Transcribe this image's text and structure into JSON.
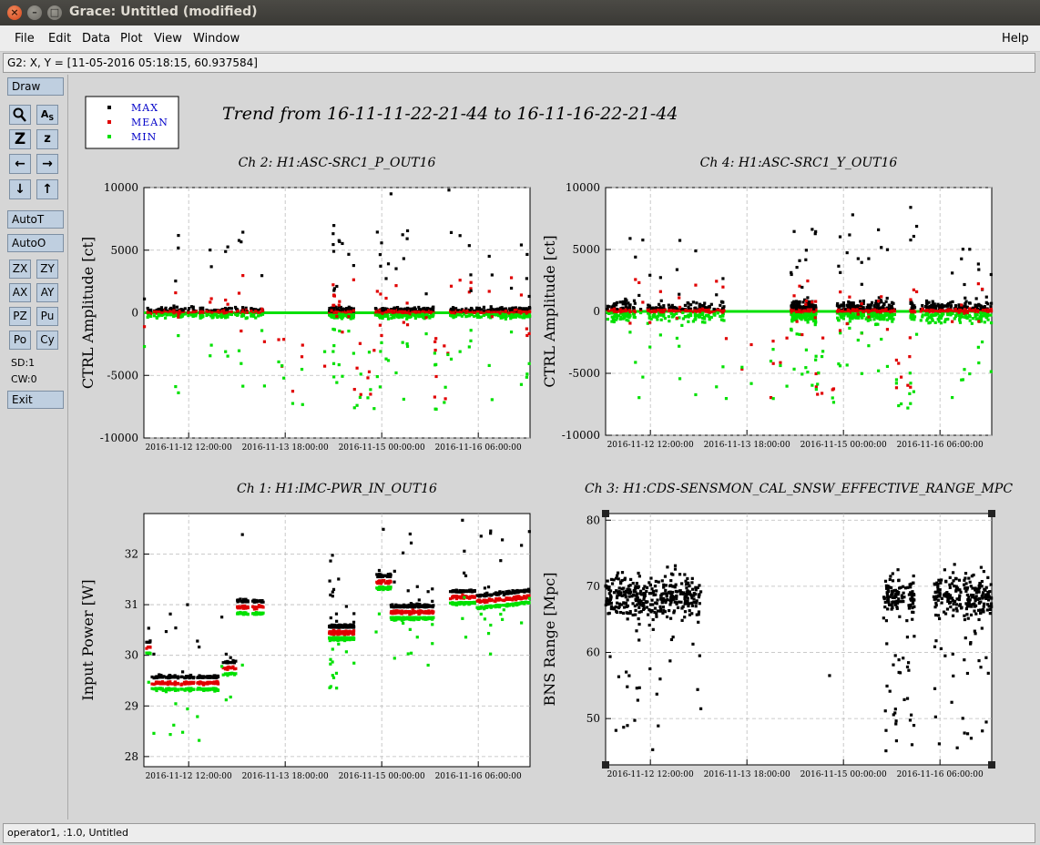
{
  "window": {
    "title": "Grace: Untitled (modified)"
  },
  "menu": [
    "File",
    "Edit",
    "Data",
    "Plot",
    "View",
    "Window"
  ],
  "help": "Help",
  "location": "G2: X, Y = [11-05-2016 05:18:15, 60.937584]",
  "toolbox": {
    "draw": "Draw",
    "autot": "AutoT",
    "autoo": "AutoO",
    "zx": "ZX",
    "zy": "ZY",
    "ax": "AX",
    "ay": "AY",
    "pz": "PZ",
    "pu": "Pu",
    "po": "Po",
    "cy": "Cy",
    "sd": "SD:1",
    "cw": "CW:0",
    "exit": "Exit"
  },
  "status": "operator1, :1.0, Untitled",
  "figure": {
    "main_title": "Trend from 16-11-11-22-21-44 to 16-11-16-22-21-44",
    "legend": [
      {
        "name": "MAX",
        "color": "#000000"
      },
      {
        "name": "MEAN",
        "color": "#e00000"
      },
      {
        "name": "MIN",
        "color": "#00e000"
      }
    ]
  },
  "chart_data": [
    {
      "type": "scatter",
      "title": "Ch 2: H1:ASC-SRC1_P_OUT16",
      "ylabel": "CTRL Amplitude [ct]",
      "ylim": [
        -10000,
        10000
      ],
      "yticks": [
        "10000",
        "5000",
        "0",
        "-5000",
        "-10000"
      ],
      "xticks": [
        "2016-11-12 12:00:00",
        "2016-11-13 18:00:00",
        "2016-11-15 00:00:00",
        "2016-11-16 06:00:00"
      ],
      "grid": true,
      "series": [
        {
          "name": "MAX",
          "values": "dense scatter around 0 to 9800"
        },
        {
          "name": "MEAN",
          "values": "around 0, spread -5000 to 5800"
        },
        {
          "name": "MIN",
          "values": "around 0, spread -9200 to 0"
        }
      ]
    },
    {
      "type": "scatter",
      "title": "Ch 4: H1:ASC-SRC1_Y_OUT16",
      "ylabel": "CTRL Amplitude [ct]",
      "ylim": [
        -10000,
        10000
      ],
      "yticks": [
        "10000",
        "5000",
        "0",
        "-5000",
        "-10000"
      ],
      "xticks": [
        "2016-11-12 12:00:00",
        "2016-11-13 18:00:00",
        "2016-11-15 00:00:00",
        "2016-11-16 06:00:00"
      ],
      "grid": true,
      "series": [
        {
          "name": "MAX",
          "values": "around 500 to 8400"
        },
        {
          "name": "MEAN",
          "values": "around 0, spread -9800 to 6500"
        },
        {
          "name": "MIN",
          "values": "around 0, spread -7000 to 0"
        }
      ]
    },
    {
      "type": "scatter",
      "title": "Ch 1: H1:IMC-PWR_IN_OUT16",
      "ylabel": "Input Power [W]",
      "ylim": [
        27.8,
        32.8
      ],
      "yticks": [
        "32",
        "31",
        "30",
        "29",
        "28"
      ],
      "xticks": [
        "2016-11-12 12:00:00",
        "2016-11-13 18:00:00",
        "2016-11-15 00:00:00",
        "2016-11-16 06:00:00"
      ],
      "grid": true,
      "series": [
        {
          "name": "MAX",
          "values": "29.5 to 32.8"
        },
        {
          "name": "MEAN",
          "values": "29.4 to 32.7"
        },
        {
          "name": "MIN",
          "values": "28.1 to 32.6"
        }
      ]
    },
    {
      "type": "scatter",
      "title": "Ch 3: H1:CDS-SENSMON_CAL_SNSW_EFFECTIVE_RANGE_MPC",
      "ylabel": "BNS Range [Mpc]",
      "ylim": [
        43,
        81
      ],
      "yticks": [
        "80",
        "70",
        "60",
        "50"
      ],
      "xticks": [
        "2016-11-12 12:00:00",
        "2016-11-13 18:00:00",
        "2016-11-15 00:00:00",
        "2016-11-16 06:00:00"
      ],
      "grid": true,
      "series": [
        {
          "name": "MAX",
          "values": "45 to 78, mostly 63 to 73"
        }
      ]
    }
  ]
}
